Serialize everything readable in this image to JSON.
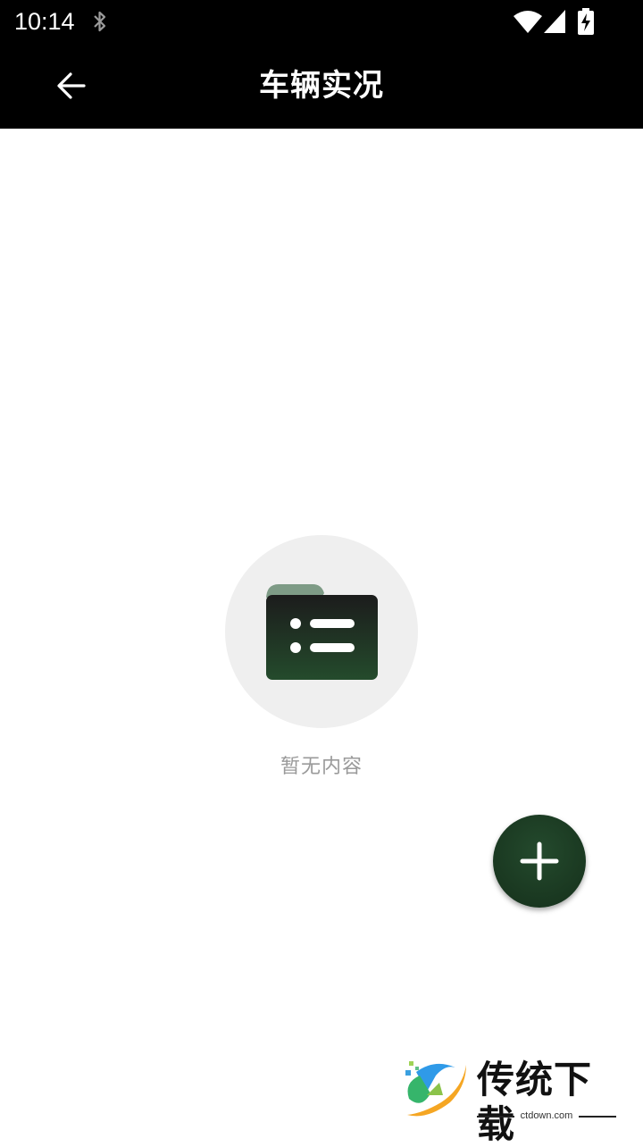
{
  "status_bar": {
    "time": "10:14",
    "icons": [
      "bluetooth-icon",
      "wifi-icon",
      "signal-icon",
      "battery-charging-icon"
    ]
  },
  "app_bar": {
    "back_icon": "arrow-left-icon",
    "title": "车辆实况"
  },
  "empty_state": {
    "icon": "folder-list-icon",
    "message": "暂无内容"
  },
  "fab": {
    "icon": "plus-icon"
  },
  "watermark": {
    "name": "传统下载",
    "url": "ctdown.com"
  },
  "colors": {
    "app_bar_bg": "#000000",
    "accent_dark_green": "#1b3a22",
    "empty_circle_bg": "#efefef",
    "empty_text": "#9a9a9a"
  }
}
